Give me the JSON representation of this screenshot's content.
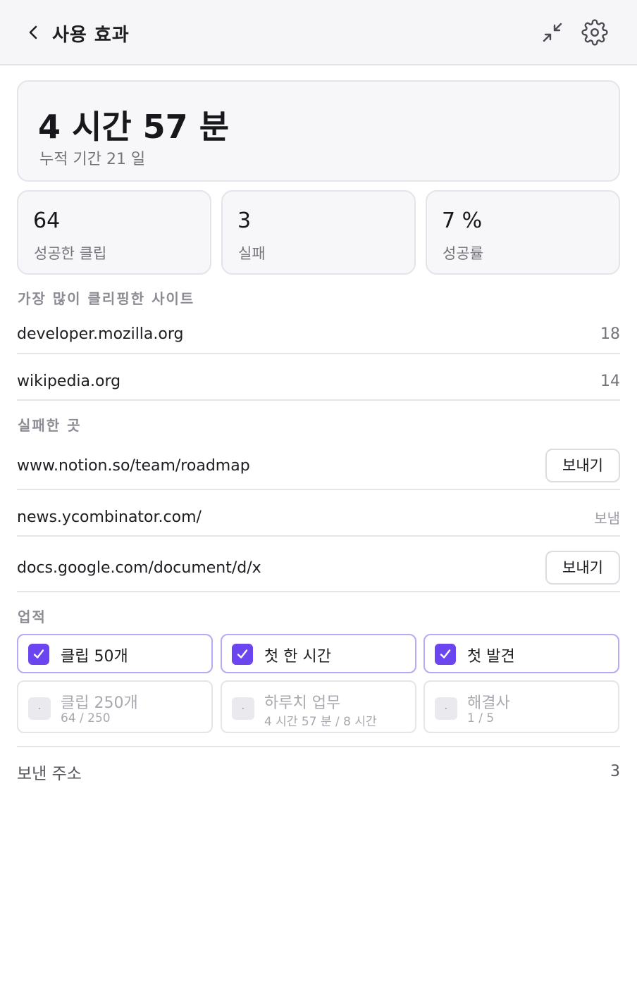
{
  "header": {
    "title": "사용 효과",
    "back_icon": "chevron-left-icon",
    "collapse_icon": "collapse-arrows-icon",
    "settings_icon": "gear-icon"
  },
  "summary": {
    "total_time": "4 시간 57 분",
    "period": "누적 기간 21 일"
  },
  "stats": [
    {
      "value": "64",
      "label": "성공한 클립"
    },
    {
      "value": "3",
      "label": "실패"
    },
    {
      "value": "7 %",
      "label": "성공률"
    }
  ],
  "top_sites": {
    "title": "가장 많이 클리핑한 사이트",
    "items": [
      {
        "site": "developer.mozilla.org",
        "count": "18"
      },
      {
        "site": "wikipedia.org",
        "count": "14"
      }
    ]
  },
  "failed": {
    "title": "실패한 곳",
    "send_label": "보내기",
    "items": [
      {
        "url": "www.notion.so/team/roadmap",
        "action": "button",
        "text": "보내기"
      },
      {
        "url": "news.ycombinator.com/",
        "action": "status",
        "text": "보냄"
      },
      {
        "url": "docs.google.com/document/d/x",
        "action": "button",
        "text": "보내기"
      }
    ]
  },
  "achievements": {
    "title": "업적",
    "done": [
      {
        "label": "클립 50개"
      },
      {
        "label": "첫 한 시간"
      },
      {
        "label": "첫 발견"
      }
    ],
    "todo": [
      {
        "label": "클립 250개",
        "progress": "64 / 250"
      },
      {
        "label": "하루치 업무",
        "progress": "4 시간 57 분 / 8 시간"
      },
      {
        "label": "해결사",
        "progress": "1 / 5"
      }
    ]
  },
  "footer": {
    "label": "보낸 주소",
    "count": "3"
  },
  "colors": {
    "accent": "#6a45f0",
    "accent_border": "#b5aaf5",
    "header_bg": "#f6f6f8",
    "card_bg": "#f7f7f9"
  }
}
